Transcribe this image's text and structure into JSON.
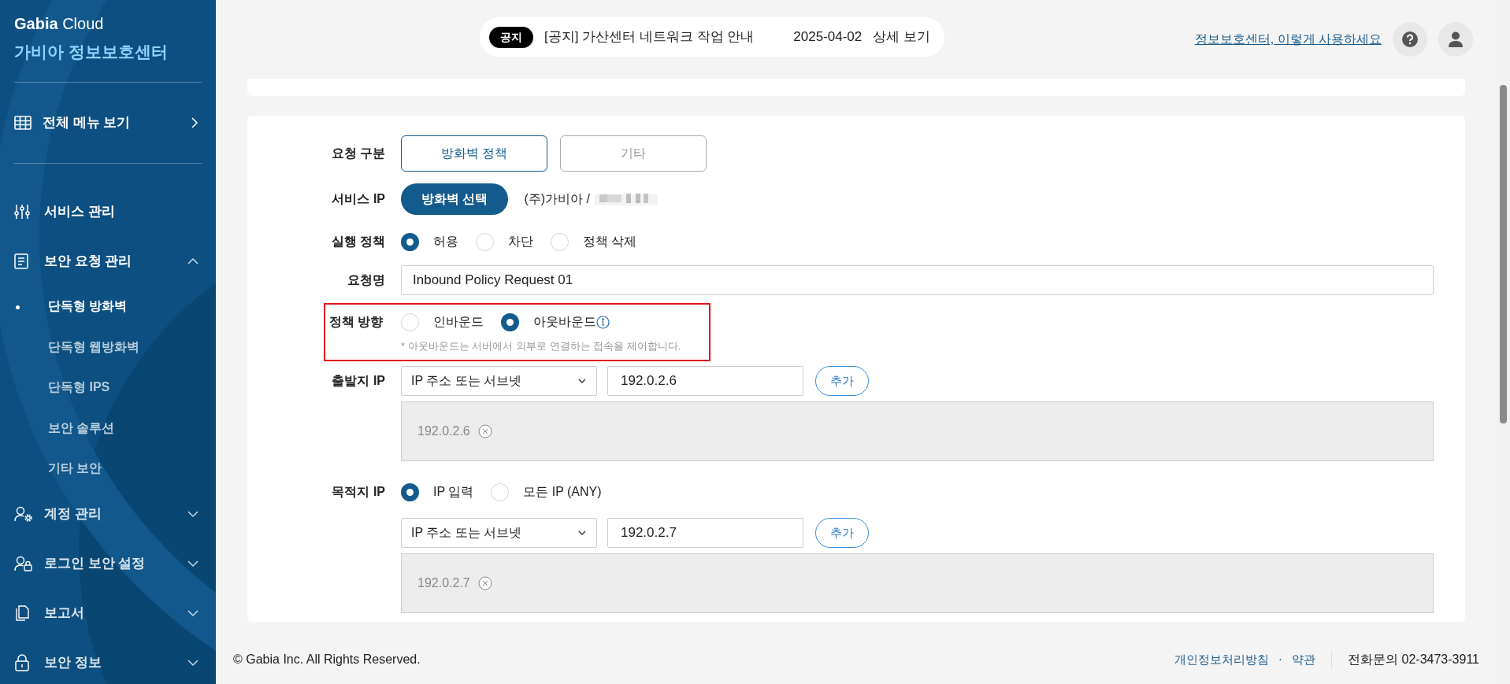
{
  "sidebar": {
    "brand": {
      "bold": "Gabia",
      "rest": "Cloud"
    },
    "title": "가비아 정보보호센터",
    "all_menu": {
      "label": "전체 메뉴 보기"
    },
    "items": [
      {
        "label": "서비스 관리"
      },
      {
        "label": "보안 요청 관리",
        "expanded": true,
        "children": [
          {
            "label": "단독형 방화벽",
            "selected": true
          },
          {
            "label": "단독형 웹방화벽",
            "selected": false
          },
          {
            "label": "단독형 IPS",
            "selected": false
          },
          {
            "label": "보안 솔루션",
            "selected": false
          },
          {
            "label": "기타 보안",
            "selected": false
          }
        ]
      },
      {
        "label": "계정 관리",
        "expanded": false
      },
      {
        "label": "로그인 보안 설정",
        "expanded": false
      },
      {
        "label": "보고서",
        "expanded": false
      },
      {
        "label": "보안 정보",
        "expanded": false
      }
    ]
  },
  "notice": {
    "badge": "공지",
    "title": "[공지] 가산센터 네트워크 작업 안내",
    "date": "2025-04-02",
    "detail": "상세 보기"
  },
  "help_link": "정보보호센터, 이렇게 사용하세요",
  "form": {
    "request_type": {
      "label": "요청 구분",
      "options": [
        {
          "label": "방화벽 정책",
          "selected": true
        },
        {
          "label": "기타",
          "selected": false
        }
      ]
    },
    "service_ip": {
      "label": "서비스 IP",
      "button": "방화벽 선택",
      "value": "(주)가비아 /"
    },
    "action": {
      "label": "실행 정책",
      "options": [
        {
          "label": "허용",
          "selected": true
        },
        {
          "label": "차단",
          "selected": false
        },
        {
          "label": "정책 삭제",
          "selected": false
        }
      ]
    },
    "request_name": {
      "label": "요청명",
      "value": "Inbound Policy Request 01"
    },
    "direction": {
      "label": "정책 방향",
      "options": [
        {
          "label": "인바운드",
          "selected": false
        },
        {
          "label": "아웃바운드",
          "selected": true
        }
      ],
      "note": "* 아웃바운드는 서버에서 외부로 연결하는 접속을 제어합니다."
    },
    "source": {
      "label": "출발지 IP",
      "select": "IP 주소 또는 서브넷",
      "value": "192.0.2.6",
      "add": "추가",
      "tags": [
        "192.0.2.6"
      ]
    },
    "destination": {
      "label": "목적지 IP",
      "options": [
        {
          "label": "IP 입력",
          "selected": true
        },
        {
          "label": "모든 IP (ANY)",
          "selected": false
        }
      ],
      "select": "IP 주소 또는 서브넷",
      "value": "192.0.2.7",
      "add": "추가",
      "tags": [
        "192.0.2.7"
      ]
    }
  },
  "footer": {
    "copyright": "© Gabia Inc. All Rights Reserved.",
    "links": [
      "개인정보처리방침",
      "약관"
    ],
    "separator": "·",
    "phone": "전화문의 02-3473-3911"
  }
}
